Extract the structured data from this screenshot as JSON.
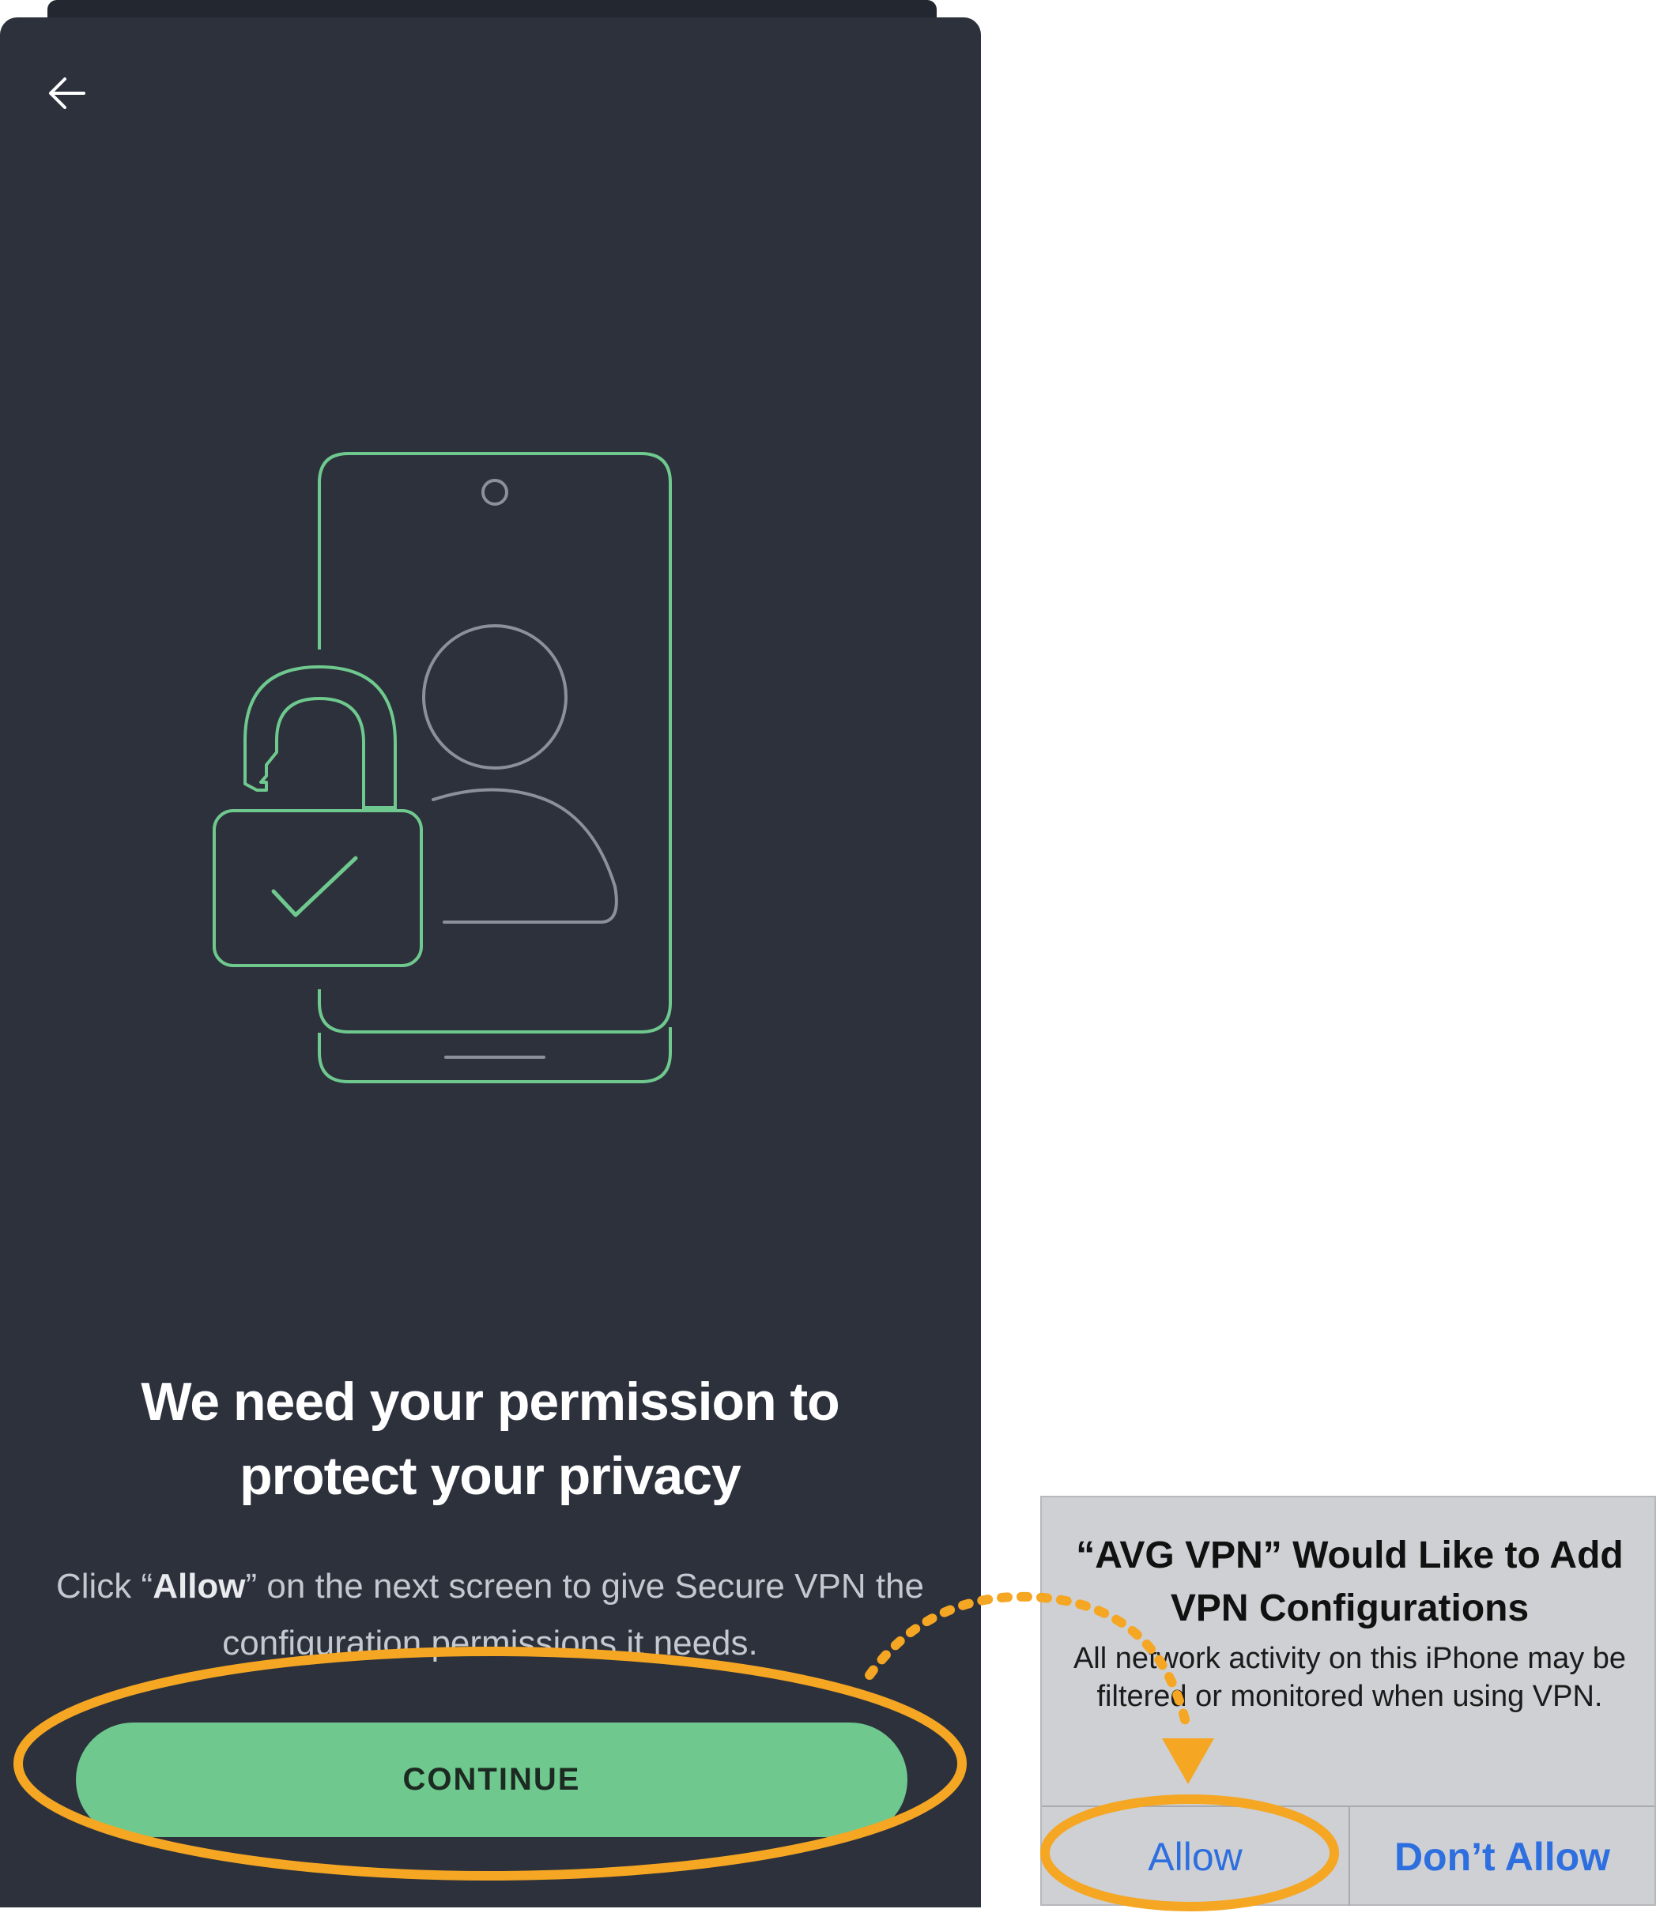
{
  "app_screen": {
    "back_icon": "arrow-left-icon",
    "illustration_icons": [
      "phone-icon",
      "person-icon",
      "unlocked-padlock-icon",
      "checkmark-icon"
    ],
    "title": "We need your permission to protect your privacy",
    "body": {
      "prefix": "Click “",
      "emphasis": "Allow",
      "suffix": "” on the next screen to give Secure VPN the configuration permissions it needs."
    },
    "continue_button": "CONTINUE"
  },
  "ios_dialog": {
    "title": "“AVG VPN” Would Like to Add VPN Configurations",
    "message": "All network activity on this iPhone may be filtered or monitored when using VPN.",
    "allow_button": "Allow",
    "dont_allow_button": "Don’t Allow"
  },
  "colors": {
    "app_background": "#2c313c",
    "accent_green": "#6fc98e",
    "illustration_gray": "#8c9099",
    "annotation_orange": "#f5a623",
    "ios_dialog_background": "#cfd0d3",
    "ios_link_blue": "#2e6fe0"
  }
}
